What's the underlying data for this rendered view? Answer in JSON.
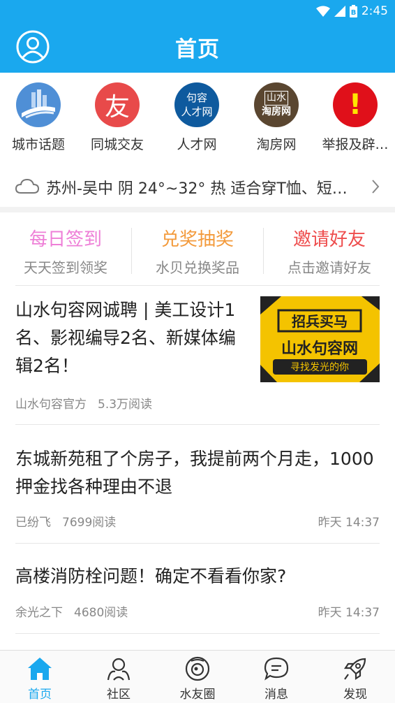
{
  "status": {
    "time": "2:45",
    "battery_glyph": "B"
  },
  "header": {
    "title": "首页"
  },
  "quick_links": [
    {
      "label": "城市话题",
      "icon": "city-topic-icon",
      "color": "#4f8fd6"
    },
    {
      "label": "同城交友",
      "icon": "friends-icon",
      "color": "#e84a4a",
      "glyph": "友"
    },
    {
      "label": "人才网",
      "icon": "talent-icon",
      "color": "#0e5a9e",
      "glyph_top": "句容",
      "glyph_bottom": "人才网"
    },
    {
      "label": "淘房网",
      "icon": "house-icon",
      "color": "#5a4630",
      "glyph_top": "山水",
      "glyph_bottom": "淘房网"
    },
    {
      "label": "举报及辟…",
      "icon": "report-icon",
      "color": "#e0101a",
      "glyph": "!"
    }
  ],
  "weather": {
    "text": "苏州-吴中 阴 24°~32° 热 适合穿T恤、短…"
  },
  "tasks": [
    {
      "title": "每日签到",
      "subtitle": "天天签到领奖",
      "color": "#ee7fd7"
    },
    {
      "title": "兑奖抽奖",
      "subtitle": "水贝兑换奖品",
      "color": "#f39a3b"
    },
    {
      "title": "邀请好友",
      "subtitle": "点击邀请好友",
      "color": "#ee4d4d"
    }
  ],
  "news": [
    {
      "title": "山水句容网诚聘 | 美工设计1名、影视编导2名、新媒体编辑2名！",
      "author": "山水句容官方",
      "reads": "5.3万阅读",
      "time": "",
      "thumb": {
        "line1": "招兵买马",
        "line2": "山水句容网",
        "line3": "寻找发光的你"
      }
    },
    {
      "title": "东城新苑租了个房子，我提前两个月走，1000押金找各种理由不退",
      "author": "已纷飞",
      "reads": "7699阅读",
      "time": "昨天 14:37"
    },
    {
      "title": "高楼消防栓问题！确定不看看你家?",
      "author": "余光之下",
      "reads": "4680阅读",
      "time": "昨天 14:37"
    }
  ],
  "nav": [
    {
      "label": "首页",
      "icon": "home-icon",
      "active": true
    },
    {
      "label": "社区",
      "icon": "community-icon",
      "active": false
    },
    {
      "label": "水友圈",
      "icon": "circle-icon",
      "active": false
    },
    {
      "label": "消息",
      "icon": "message-icon",
      "active": false
    },
    {
      "label": "发现",
      "icon": "discover-icon",
      "active": false
    }
  ],
  "colors": {
    "brand": "#1aa8ee"
  }
}
